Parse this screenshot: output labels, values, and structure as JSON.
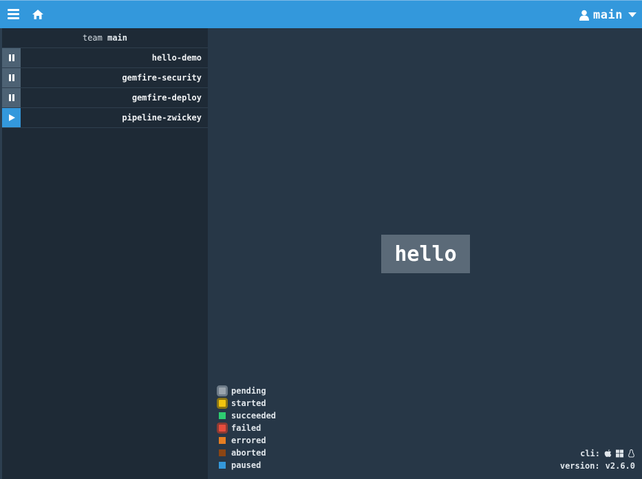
{
  "header": {
    "user_name": "main",
    "colors": {
      "bar": "#3398dc"
    }
  },
  "sidebar": {
    "team_prefix": "team",
    "team_name": "main",
    "pipelines": [
      {
        "name": "hello-demo",
        "state": "paused",
        "toggle_icon": "pause-icon"
      },
      {
        "name": "gemfire-security",
        "state": "paused",
        "toggle_icon": "pause-icon"
      },
      {
        "name": "gemfire-deploy",
        "state": "paused",
        "toggle_icon": "pause-icon"
      },
      {
        "name": "pipeline-zwickey",
        "state": "active",
        "toggle_icon": "play-icon"
      }
    ]
  },
  "main": {
    "job_name": "hello",
    "legend": [
      {
        "label": "pending",
        "color": "#9aa4ad",
        "ring": "#6d7b88"
      },
      {
        "label": "started",
        "color": "#f1c40f",
        "ring": "#8a7414"
      },
      {
        "label": "succeeded",
        "color": "#2ecc71"
      },
      {
        "label": "failed",
        "color": "#e74c3c",
        "ring": "#8b3a33"
      },
      {
        "label": "errored",
        "color": "#e67e22"
      },
      {
        "label": "aborted",
        "color": "#8b4513"
      },
      {
        "label": "paused",
        "color": "#3498db"
      }
    ]
  },
  "footer": {
    "cli_label": "cli:",
    "version_label": "version:",
    "version_value": "v2.6.0",
    "cli_icons": [
      "apple-icon",
      "windows-icon",
      "linux-icon"
    ]
  }
}
